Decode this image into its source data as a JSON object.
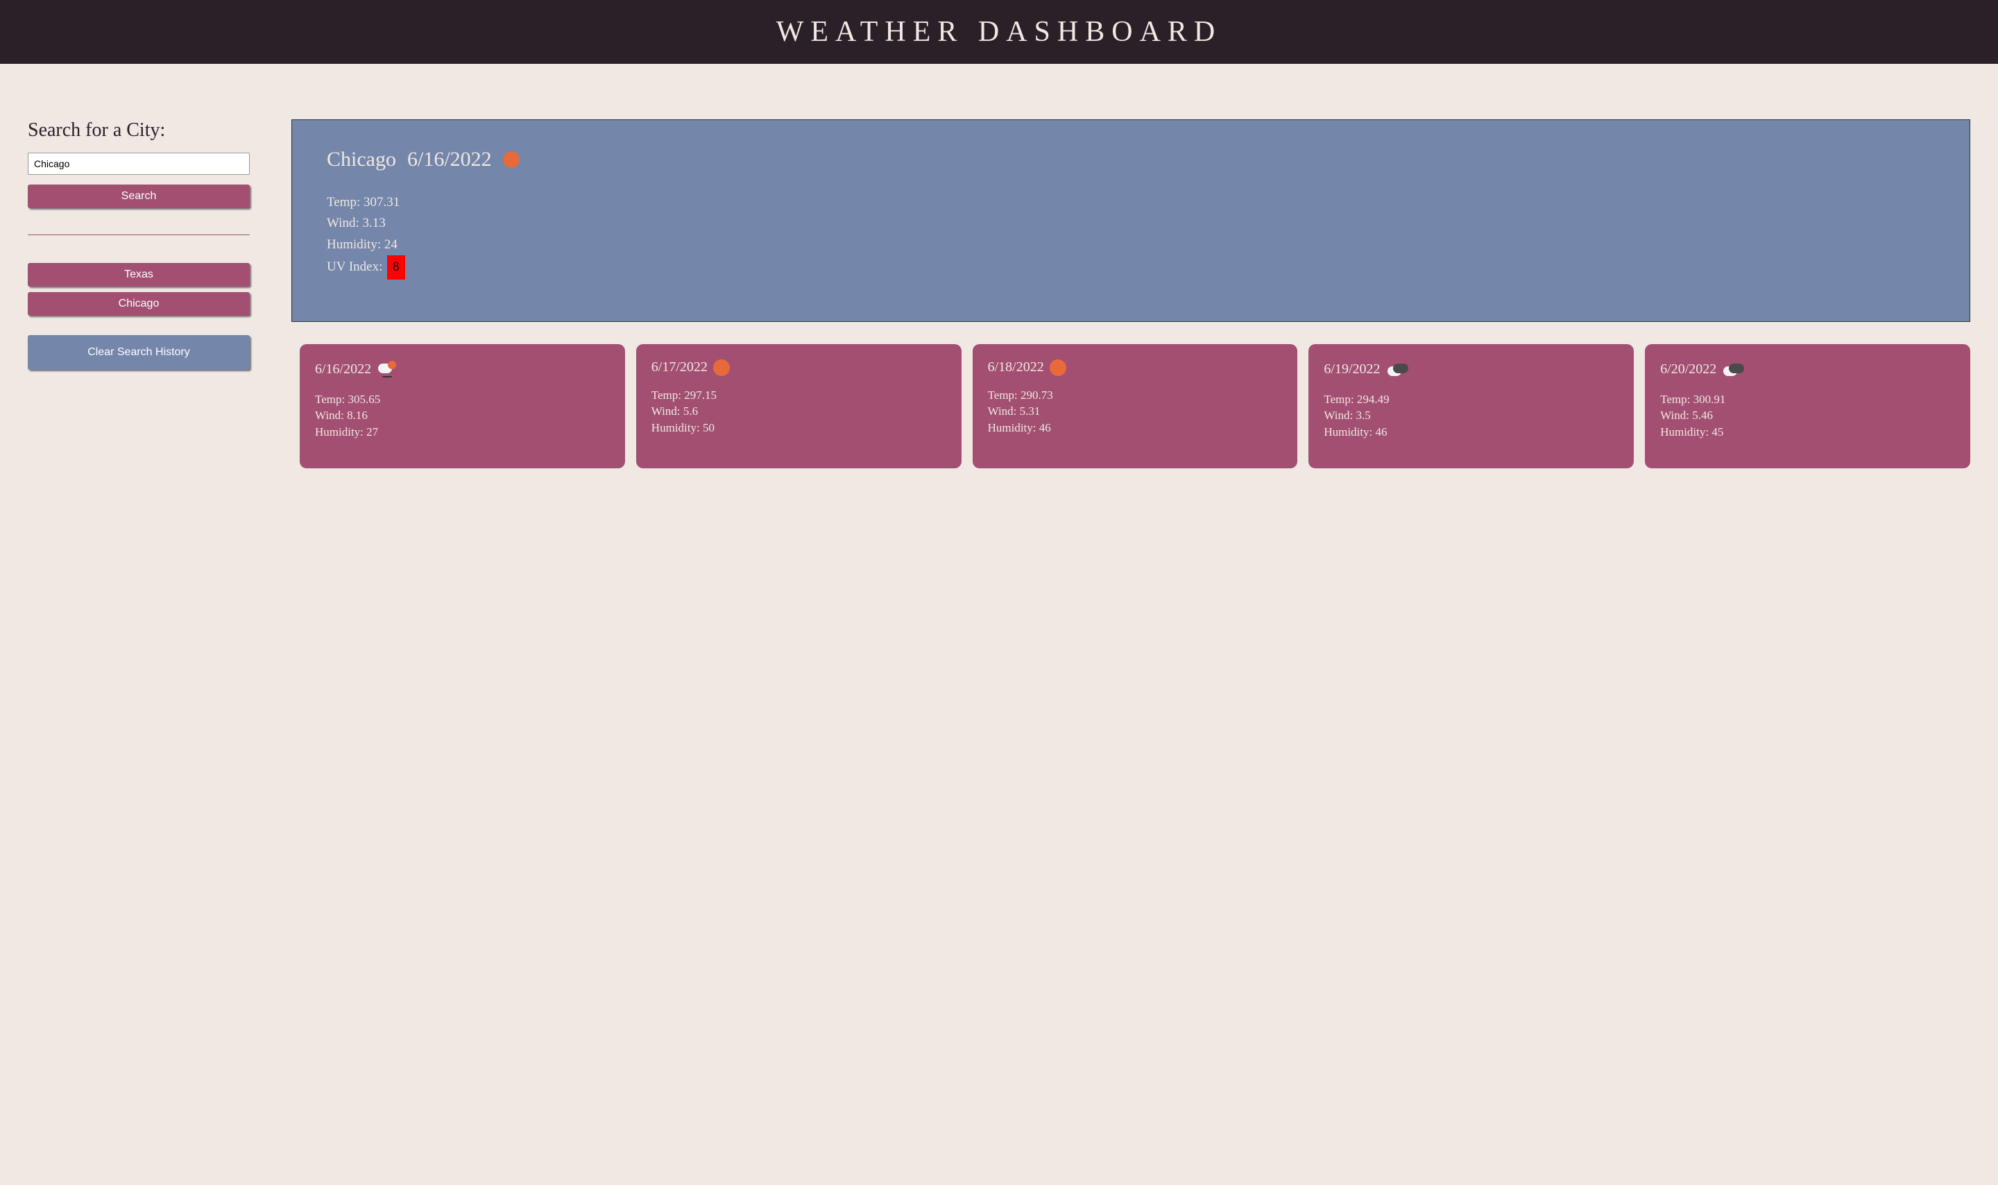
{
  "header": {
    "title": "WEATHER DASHBOARD"
  },
  "sidebar": {
    "search_heading": "Search for a City:",
    "search_value": "Chicago",
    "search_placeholder": "",
    "search_button": "Search",
    "history": [
      "Texas",
      "Chicago"
    ],
    "clear_button": "Clear Search History"
  },
  "current": {
    "city": "Chicago",
    "date": "6/16/2022",
    "icon": "sun",
    "temp_label": "Temp:",
    "temp": "307.31",
    "wind_label": "Wind:",
    "wind": "3.13",
    "humidity_label": "Humidity:",
    "humidity": "24",
    "uv_label": "UV Index:",
    "uv": "8",
    "uv_color": "#ff0000"
  },
  "forecast": [
    {
      "date": "6/16/2022",
      "icon": "rain",
      "temp": "305.65",
      "wind": "8.16",
      "humidity": "27"
    },
    {
      "date": "6/17/2022",
      "icon": "sun",
      "temp": "297.15",
      "wind": "5.6",
      "humidity": "50"
    },
    {
      "date": "6/18/2022",
      "icon": "sun",
      "temp": "290.73",
      "wind": "5.31",
      "humidity": "46"
    },
    {
      "date": "6/19/2022",
      "icon": "clouds",
      "temp": "294.49",
      "wind": "3.5",
      "humidity": "46"
    },
    {
      "date": "6/20/2022",
      "icon": "clouds",
      "temp": "300.91",
      "wind": "5.46",
      "humidity": "45"
    }
  ],
  "labels": {
    "temp": "Temp:",
    "wind": "Wind:",
    "humidity": "Humidity:"
  },
  "colors": {
    "rose": "#a34f72",
    "slate": "#7486aa",
    "bg": "#efe8e3",
    "dark": "#2a2028"
  }
}
